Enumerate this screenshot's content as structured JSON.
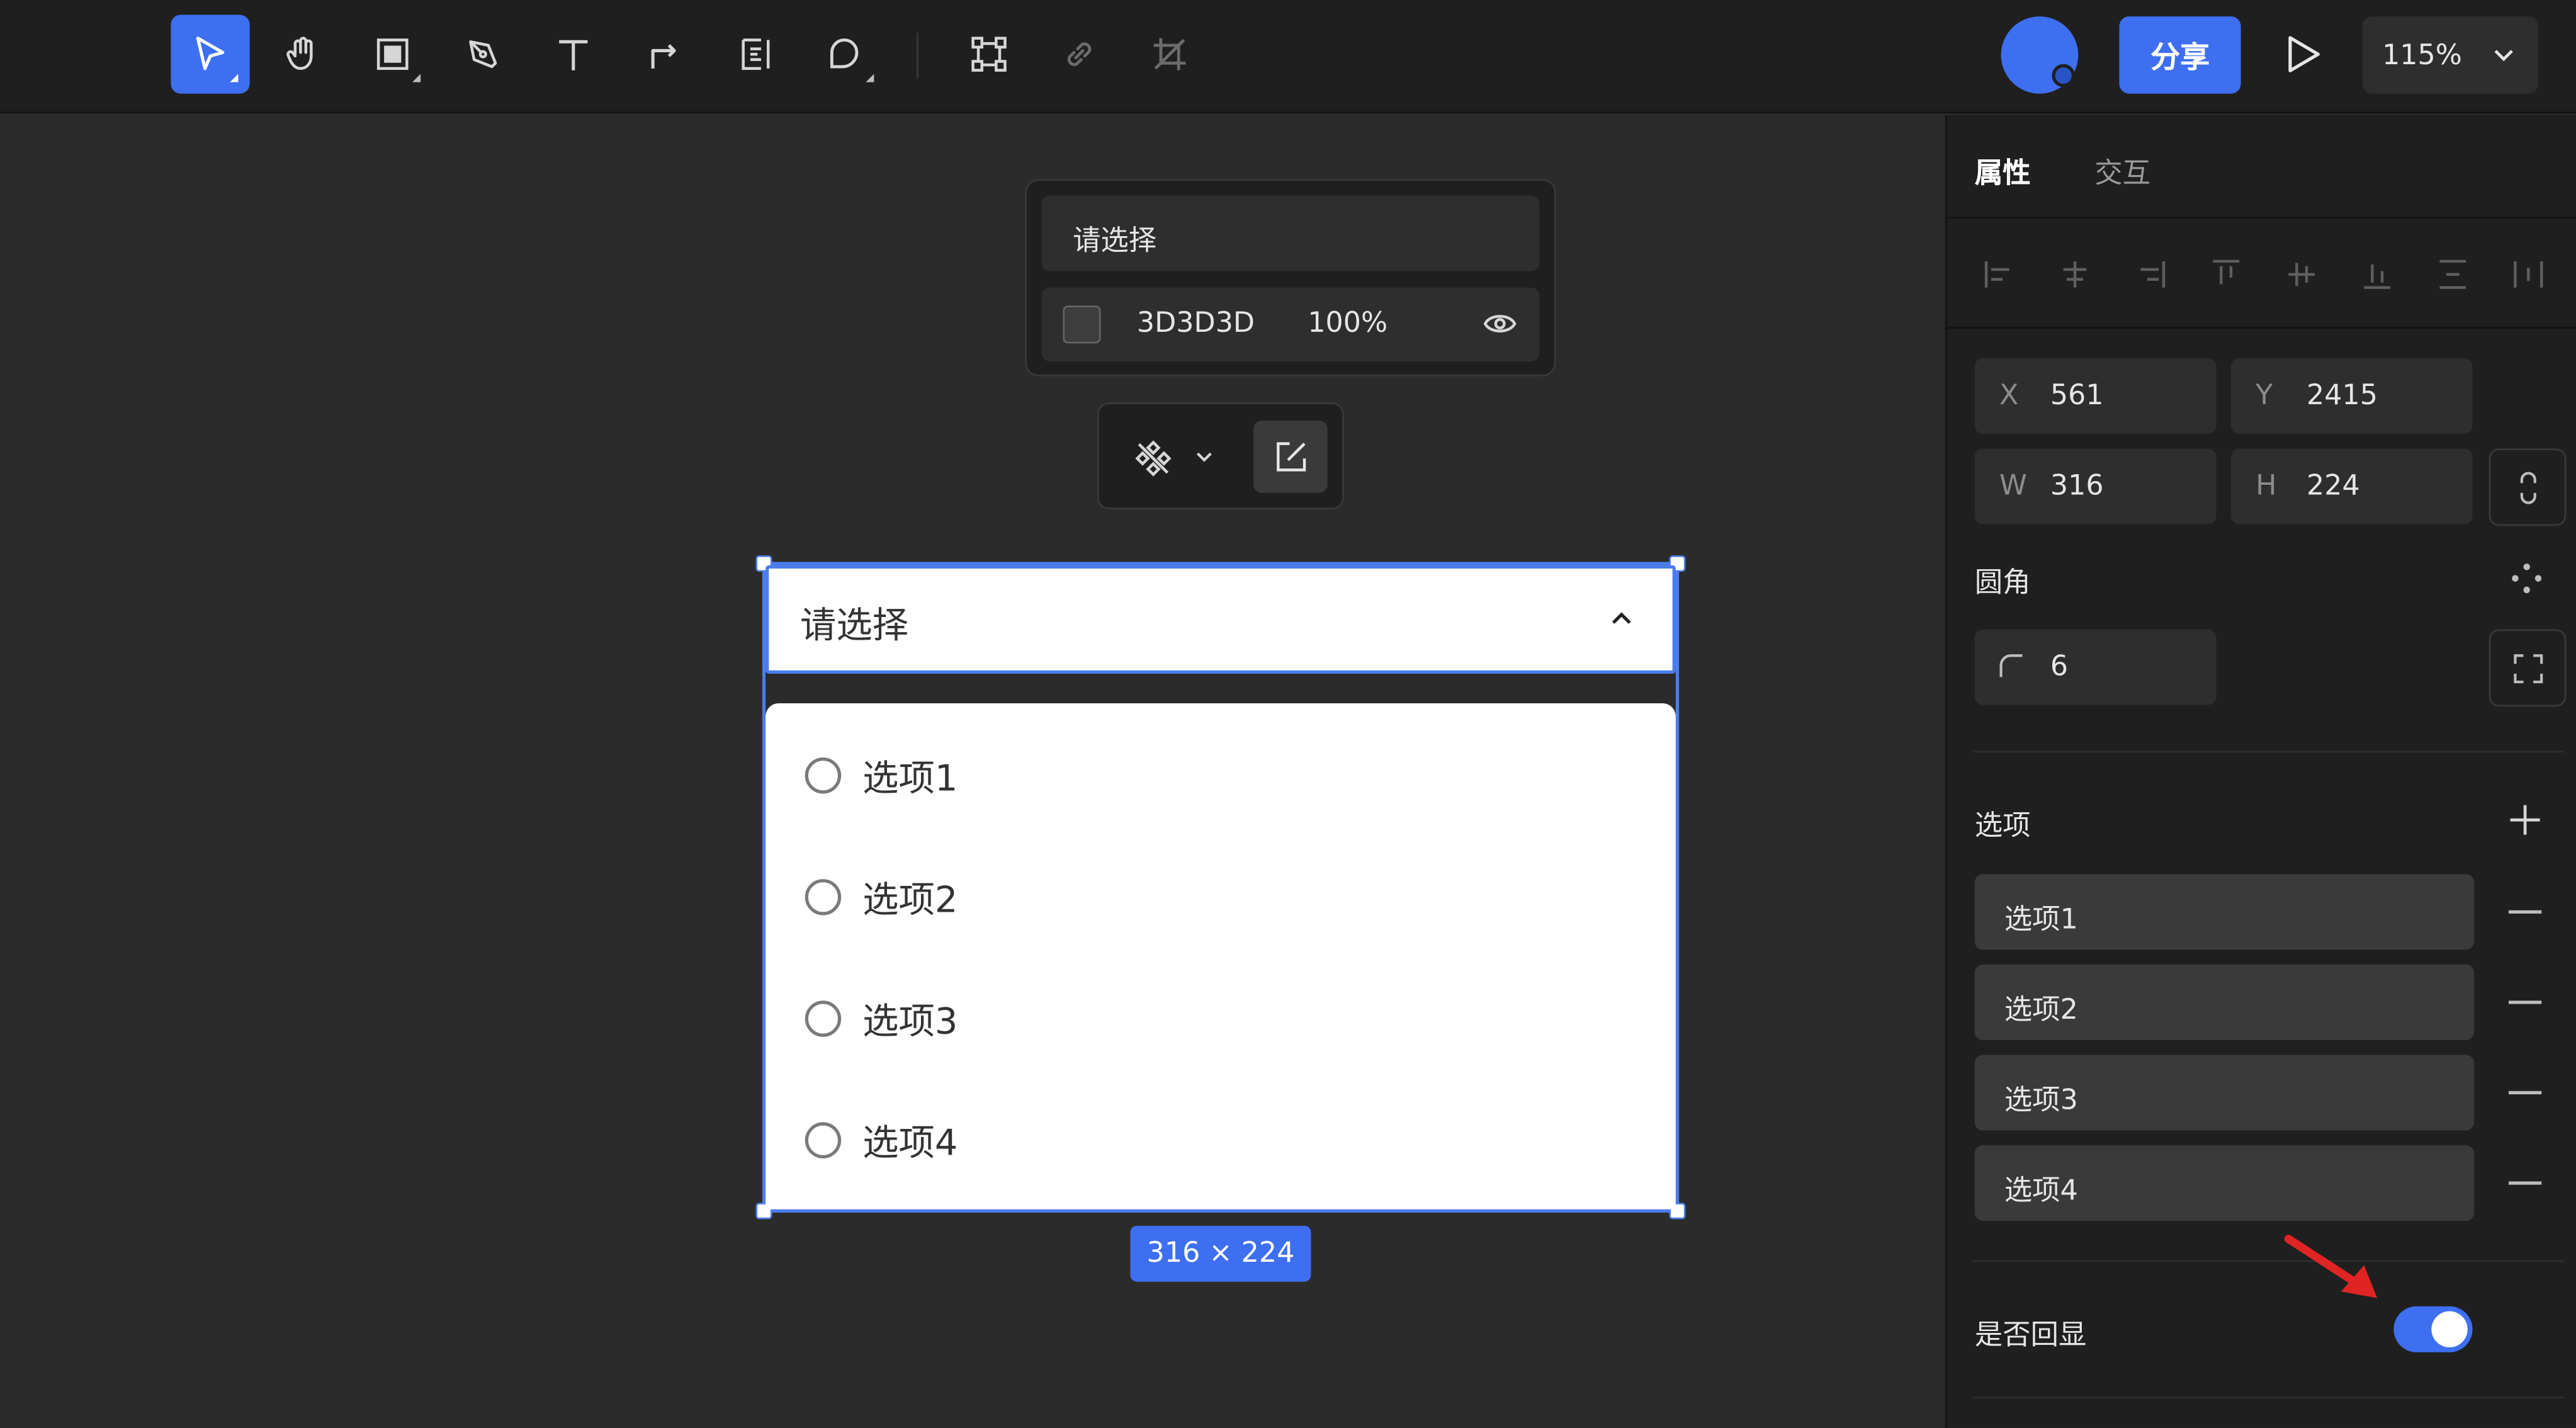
{
  "toolbar": {
    "tools": [
      {
        "icon": "pointer-icon",
        "active": true
      },
      {
        "icon": "hand-icon",
        "active": false
      },
      {
        "icon": "frame-icon",
        "active": false
      },
      {
        "icon": "pen-icon",
        "active": false
      },
      {
        "icon": "text-icon",
        "active": false
      },
      {
        "icon": "connector-icon",
        "active": false
      },
      {
        "icon": "form-icon",
        "active": false
      },
      {
        "icon": "shape-icon",
        "active": false
      },
      {
        "icon": "component-icon",
        "active": false
      },
      {
        "icon": "link-icon",
        "active": false
      },
      {
        "icon": "crop-icon",
        "active": false
      }
    ],
    "share_label": "分享",
    "zoom_label": "115%"
  },
  "fill_popup": {
    "title": "请选择",
    "hex": "3D3D3D",
    "opacity": "100%"
  },
  "component": {
    "placeholder": "请选择",
    "options": [
      "选项1",
      "选项2",
      "选项3",
      "选项4"
    ],
    "size_label": "316 × 224"
  },
  "panel": {
    "tabs": [
      "属性",
      "交互"
    ],
    "x": {
      "key": "X",
      "value": "561"
    },
    "y": {
      "key": "Y",
      "value": "2415"
    },
    "w": {
      "key": "W",
      "value": "316"
    },
    "h": {
      "key": "H",
      "value": "224"
    },
    "radius_title": "圆角",
    "radius_value": "6",
    "options_title": "选项",
    "options": [
      "选项1",
      "选项2",
      "选项3",
      "选项4"
    ],
    "echo_label": "是否回显",
    "echo_on": true
  },
  "colors": {
    "accent": "#3d6ff0",
    "canvas": "#2b2b2b",
    "panel": "#1f1f1f",
    "arrow": "#e02424"
  }
}
